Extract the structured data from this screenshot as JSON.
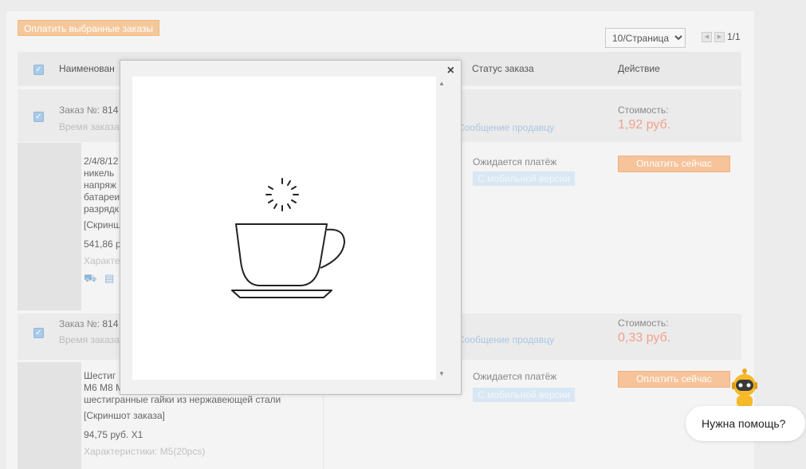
{
  "toolbar": {
    "pay_selected_label": "Оплатить выбранные заказы",
    "per_page": "10/Страница",
    "per_page_options": [
      "10/Страница"
    ],
    "page_count": "1/1"
  },
  "table_header": {
    "name": "Наименован",
    "status": "Статус заказа",
    "action": "Действие"
  },
  "orders": [
    {
      "number_label": "Заказ №:",
      "number_value": "814",
      "time_label": "Время заказа",
      "message_seller": "Сообщение продавцу",
      "cost_label": "Стоимость:",
      "cost": "1,92 руб.",
      "item": {
        "lines": [
          "2/4/8/12",
          "никель",
          "напряж",
          "батареи",
          "разрядк"
        ],
        "screenshot": "[Скринш",
        "price": "541,86 р",
        "characteristics": "Характе",
        "status": "Ожидается платёж",
        "mobile": "С мобильной версии",
        "pay_now": "Оплатить сейчас"
      }
    },
    {
      "number_label": "Заказ №:",
      "number_value": "814",
      "time_label": "Время заказа",
      "message_seller": "Сообщение продавцу",
      "cost_label": "Стоимость:",
      "cost": "0,33 руб.",
      "item": {
        "lines": [
          "Шестиг",
          "M6 M8 M",
          "шестигранные гайки из нержавеющей стали"
        ],
        "screenshot": "[Скриншот заказа]",
        "price": "94,75 руб. X1",
        "characteristics": "Характеристики: M5(20pcs)",
        "status": "Ожидается платёж",
        "mobile": "С мобильной версии",
        "pay_now": "Оплатить сейчас"
      }
    }
  ],
  "modal": {
    "close": "×",
    "scroll_up": "▲",
    "scroll_down": "▼"
  },
  "pager": {
    "prev": "◀",
    "next": "▶"
  },
  "help": {
    "label": "Нужна помощь?"
  },
  "icons": {
    "checkbox": "check-icon",
    "loading": "coffee-cup-loading-icon",
    "delivery": "truck-icon",
    "store": "store-icon",
    "assistant": "robot-avatar-icon"
  },
  "colors": {
    "accent_orange": "#f6c39a",
    "price_red": "#f3a08a",
    "link_blue": "#a9c6e3",
    "checkbox_blue": "#a7cbe8"
  }
}
